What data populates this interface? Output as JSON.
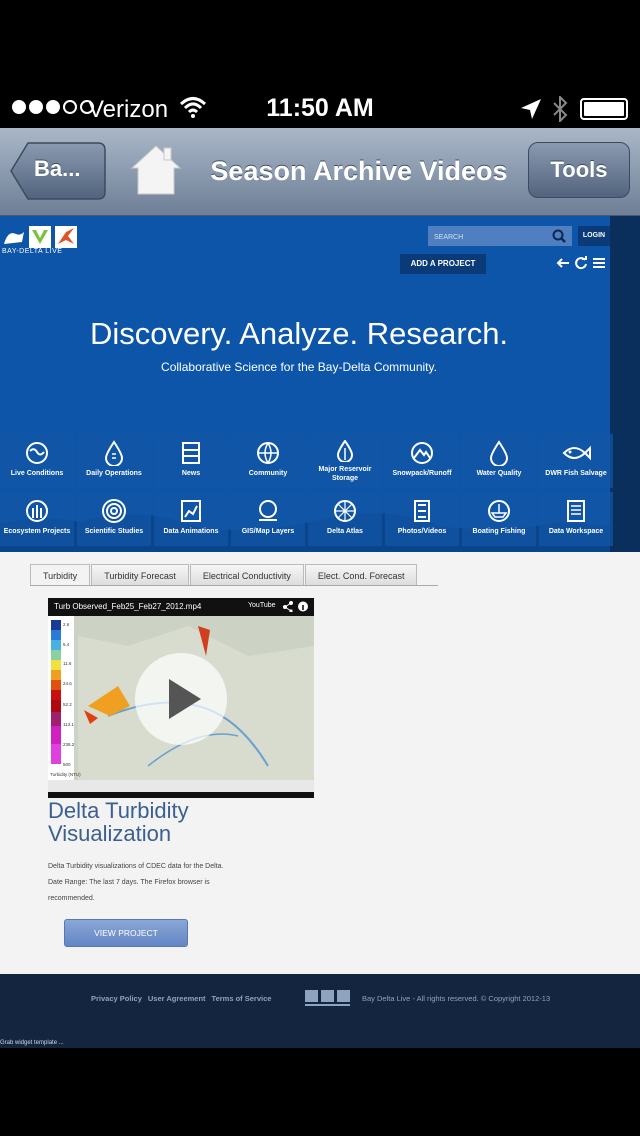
{
  "status_bar": {
    "carrier": "Verizon",
    "time": "11:50 AM",
    "signal_bars": 3,
    "signal_total": 5
  },
  "nav": {
    "back_label": "Ba...",
    "title": "Season Archive Videos",
    "tools_label": "Tools"
  },
  "site": {
    "logo_text": "BAY-DELTA LIVE",
    "search_placeholder": "SEARCH",
    "login_label": "LOGIN",
    "add_project_label": "ADD A PROJECT",
    "headline": "Discovery. Analyze. Research.",
    "subline": "Collaborative Science for the Bay-Delta Community.",
    "tiles": [
      {
        "label": "Live Conditions",
        "icon": "globe-icon"
      },
      {
        "label": "Daily Operations",
        "icon": "drop-gauge-icon"
      },
      {
        "label": "News",
        "icon": "film-icon"
      },
      {
        "label": "Community",
        "icon": "globe-network-icon"
      },
      {
        "label": "Major Reservoir Storage",
        "icon": "reservoir-drop-icon"
      },
      {
        "label": "Snowpack/Runoff",
        "icon": "mountain-icon"
      },
      {
        "label": "Water Quality",
        "icon": "water-drop-icon"
      },
      {
        "label": "DWR Fish Salvage",
        "icon": "fish-icon"
      },
      {
        "label": "Ecosystem Projects",
        "icon": "wheat-icon"
      },
      {
        "label": "Scientific Studies",
        "icon": "target-icon"
      },
      {
        "label": "Data Animations",
        "icon": "chart-icon"
      },
      {
        "label": "GIS/Map Layers",
        "icon": "map-pin-icon"
      },
      {
        "label": "Delta Atlas",
        "icon": "compass-icon"
      },
      {
        "label": "Photos/Videos",
        "icon": "filmstrip-icon"
      },
      {
        "label": "Boating Fishing",
        "icon": "boat-icon"
      },
      {
        "label": "Data Workspace",
        "icon": "document-icon"
      }
    ],
    "tabs": [
      "Turbidity",
      "Turbidity Forecast",
      "Electrical Conductivity",
      "Elect. Cond. Forecast"
    ],
    "active_tab": "Turbidity",
    "video": {
      "title": "Turb Observed_Feb25_Feb27_2012.mp4",
      "provider": "YouTube",
      "legend_values": [
        "2.6",
        "5.4",
        "11.6",
        "24.6",
        "52.2",
        "113.1",
        "238.2",
        "500"
      ],
      "legend_label": "Turbidity (NTU)"
    },
    "project_title": "Delta Turbidity Visualization",
    "description_lines": [
      "Delta Turbidity visualizations of CDEC data for the Delta.",
      "Date Range: The last 7 days. The Firefox browser is",
      "recommended."
    ],
    "view_project_label": "VIEW PROJECT",
    "footer": {
      "links": [
        "Privacy Policy",
        "User Agreement",
        "Terms of Service"
      ],
      "copyright": "Bay Delta Live - All rights reserved. © Copyright 2012-13",
      "grab_text": "Grab widget template ..."
    },
    "colors": {
      "hero_blue": "#0c55a8",
      "footer_navy": "#14263f",
      "title_blue": "#3b5f91"
    }
  }
}
